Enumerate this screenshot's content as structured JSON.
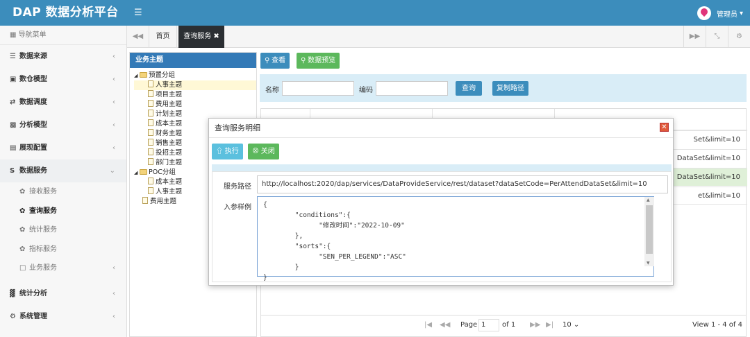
{
  "app": {
    "title": "DAP 数据分析平台",
    "menu_icon": "menu-icon",
    "user": "管理员"
  },
  "sidebar": {
    "header": "导航菜单",
    "items": [
      {
        "label": "数据来源",
        "icon": "database-icon"
      },
      {
        "label": "数仓模型",
        "icon": "cubes-icon"
      },
      {
        "label": "数据调度",
        "icon": "shuffle-icon"
      },
      {
        "label": "分析模型",
        "icon": "sitemap-icon"
      },
      {
        "label": "展现配置",
        "icon": "film-icon"
      },
      {
        "label": "数据服务",
        "icon": "s-icon"
      }
    ],
    "subitems": [
      "接收服务",
      "查询服务",
      "统计服务",
      "指标服务",
      "业务服务"
    ],
    "bottom_items": [
      {
        "label": "统计分析",
        "icon": "bar-chart-icon"
      },
      {
        "label": "系统管理",
        "icon": "gear-icon"
      }
    ]
  },
  "tabs": {
    "home": "首页",
    "current": "查询服务"
  },
  "tree": {
    "header": "业务主题",
    "group1": "预置分组",
    "group1_items": [
      "人事主题",
      "项目主题",
      "费用主题",
      "计划主题",
      "成本主题",
      "财务主题",
      "销售主题",
      "投招主题",
      "部门主题"
    ],
    "group2": "POC分组",
    "group2_items": [
      "成本主题",
      "人事主题"
    ],
    "extra": "费用主题"
  },
  "toolbar": {
    "view": "查看",
    "preview": "数据预览"
  },
  "search": {
    "name_label": "名称",
    "code_label": "编码",
    "query": "查询",
    "copy": "复制路径"
  },
  "grid": {
    "rows": [
      "Set&limit=10",
      "DataSet&limit=10",
      "DataSet&limit=10",
      "et&limit=10"
    ]
  },
  "pager": {
    "page_label": "Page",
    "page_value": "1",
    "of": "of 1",
    "page_size": "10",
    "view": "View 1 - 4 of 4"
  },
  "modal": {
    "title": "查询服务明细",
    "execute": "执行",
    "close": "关闭",
    "path_label": "服务路径",
    "path_value": "http://localhost:2020/dap/services/DataProvideService/rest/dataset?dataSetCode=PerAttendDataSet&limit=10",
    "param_label": "入参样例",
    "param_value": "{\n        \"conditions\":{\n              \"修改时间\":\"2022-10-09\"\n        },\n        \"sorts\":{\n              \"SEN_PER_LEGEND\":\"ASC\"\n        }\n}"
  }
}
